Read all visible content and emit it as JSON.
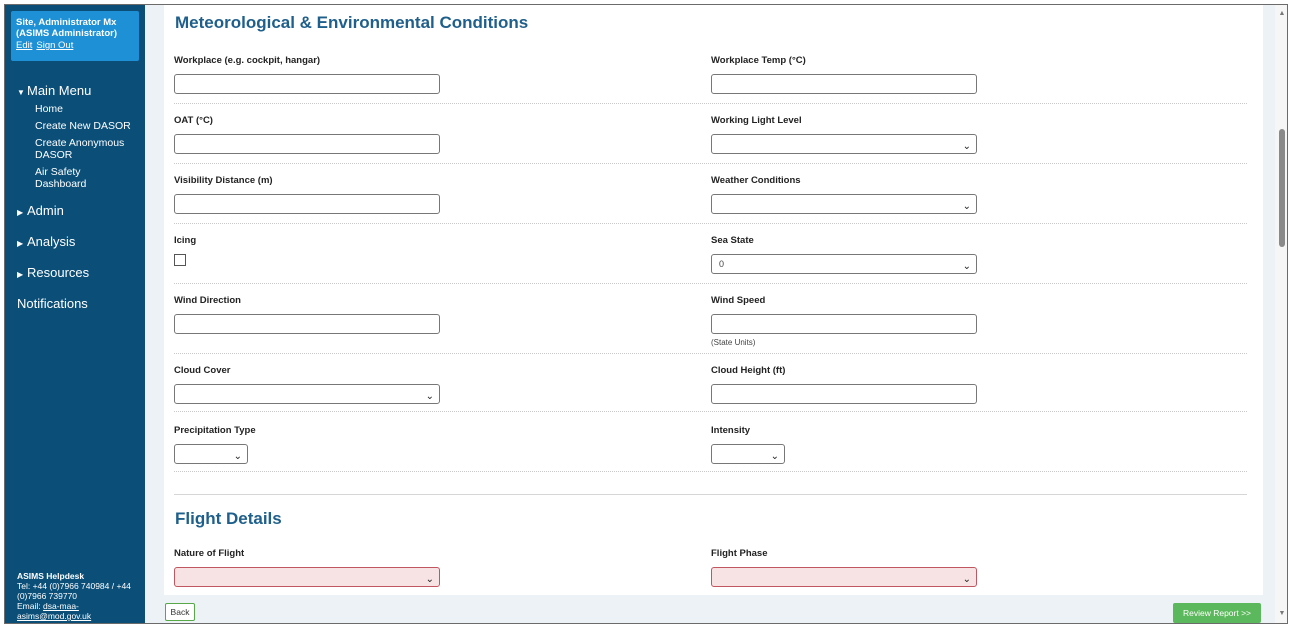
{
  "sidebar": {
    "user_name": "Site, Administrator Mx",
    "user_role": "(ASIMS Administrator)",
    "edit_label": "Edit",
    "signout_label": "Sign Out",
    "main_menu": "Main Menu",
    "main_items": [
      "Home",
      "Create New DASOR",
      "Create Anonymous DASOR",
      "Air Safety Dashboard"
    ],
    "admin": "Admin",
    "analysis": "Analysis",
    "resources": "Resources",
    "notifications": "Notifications",
    "helpdesk": {
      "title": "ASIMS Helpdesk",
      "tel": "Tel: +44 (0)7966 740984 / +44 (0)7966 739770",
      "email_prefix": "Email: ",
      "email": "dsa-maa-asims@mod.gov.uk"
    }
  },
  "met": {
    "title": "Meteorological & Environmental Conditions",
    "workplace": "Workplace (e.g. cockpit, hangar)",
    "workplace_temp": "Workplace Temp (°C)",
    "oat": "OAT (°C)",
    "working_light": "Working Light Level",
    "visibility": "Visibility Distance (m)",
    "weather": "Weather Conditions",
    "icing": "Icing",
    "sea_state": "Sea State",
    "sea_state_value": "0",
    "wind_direction": "Wind Direction",
    "wind_speed": "Wind Speed",
    "wind_speed_hint": "(State Units)",
    "cloud_cover": "Cloud Cover",
    "cloud_height": "Cloud Height (ft)",
    "precip_type": "Precipitation Type",
    "intensity": "Intensity"
  },
  "flight": {
    "title": "Flight Details",
    "nature": "Nature of Flight",
    "phase": "Flight Phase"
  },
  "footer": {
    "back": "Back",
    "review": "Review Report >>"
  },
  "colors": {
    "sidebar": "#0b4f79",
    "user_box": "#1e90d6",
    "title": "#1f5f8b",
    "required_bg": "#f7e2e4",
    "review_btn": "#5cb85c"
  }
}
